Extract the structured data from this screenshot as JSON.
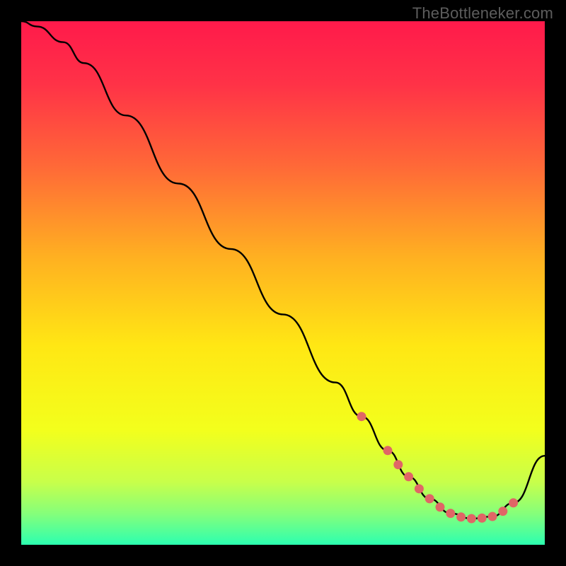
{
  "watermark": "TheBottleneker.com",
  "chart_data": {
    "type": "line",
    "title": "",
    "xlabel": "",
    "ylabel": "",
    "xlim": [
      0,
      100
    ],
    "ylim": [
      0,
      100
    ],
    "series": [
      {
        "name": "curve",
        "x": [
          0,
          3,
          8,
          12,
          20,
          30,
          40,
          50,
          60,
          65,
          70,
          74,
          78,
          82,
          86,
          90,
          94,
          100
        ],
        "y": [
          100,
          99,
          96,
          92,
          82,
          69,
          56.5,
          44,
          31,
          24.5,
          18,
          13,
          8.8,
          6.0,
          5.0,
          5.4,
          8.0,
          17
        ]
      }
    ],
    "markers": {
      "name": "highlight-dots",
      "color": "#e06666",
      "x": [
        65,
        70,
        72,
        74,
        76,
        78,
        80,
        82,
        84,
        86,
        88,
        90,
        92,
        94
      ],
      "y": [
        24.5,
        18,
        15.3,
        13,
        10.7,
        8.8,
        7.2,
        6.0,
        5.3,
        5.0,
        5.1,
        5.4,
        6.4,
        8.0
      ]
    },
    "background_gradient": {
      "stops": [
        {
          "pos": 0.0,
          "color": "#ff1a4b"
        },
        {
          "pos": 0.12,
          "color": "#ff3247"
        },
        {
          "pos": 0.28,
          "color": "#ff6a37"
        },
        {
          "pos": 0.45,
          "color": "#ffb021"
        },
        {
          "pos": 0.62,
          "color": "#ffe714"
        },
        {
          "pos": 0.78,
          "color": "#f3ff1c"
        },
        {
          "pos": 0.88,
          "color": "#c8ff4a"
        },
        {
          "pos": 0.94,
          "color": "#86ff7a"
        },
        {
          "pos": 1.0,
          "color": "#2cffb0"
        }
      ]
    }
  }
}
